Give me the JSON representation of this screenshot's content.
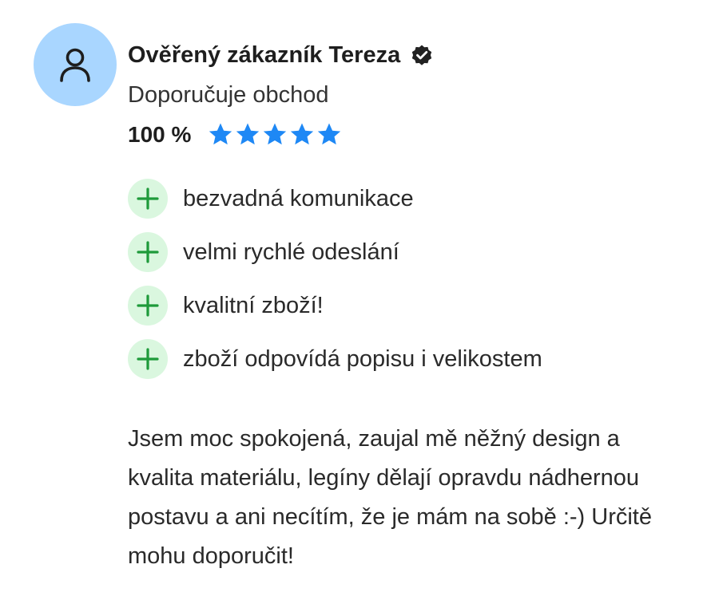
{
  "reviewer": {
    "name": "Ověřený zákazník Tereza",
    "avatar_icon": "user-icon",
    "verified_icon": "verified-check-icon"
  },
  "recommendation": "Doporučuje obchod",
  "rating": {
    "percent_label": "100 %",
    "stars_filled": 5,
    "stars_total": 5,
    "star_color": "#1e88f5"
  },
  "pros": [
    {
      "label": "bezvadná komunikace"
    },
    {
      "label": "velmi rychlé odeslání"
    },
    {
      "label": "kvalitní zboží!"
    },
    {
      "label": "zboží odpovídá popisu i velikostem"
    }
  ],
  "comment": "Jsem moc spokojená, zaujal mě něžný design a kvalita materiálu, legíny dělají opravdu nádhernou postavu a ani necítím, že je mám na sobě :-) Určitě mohu doporučit!",
  "colors": {
    "avatar_bg": "#a9d6ff",
    "plus_badge_bg": "#daf7df",
    "plus_color": "#1e9a3a"
  }
}
